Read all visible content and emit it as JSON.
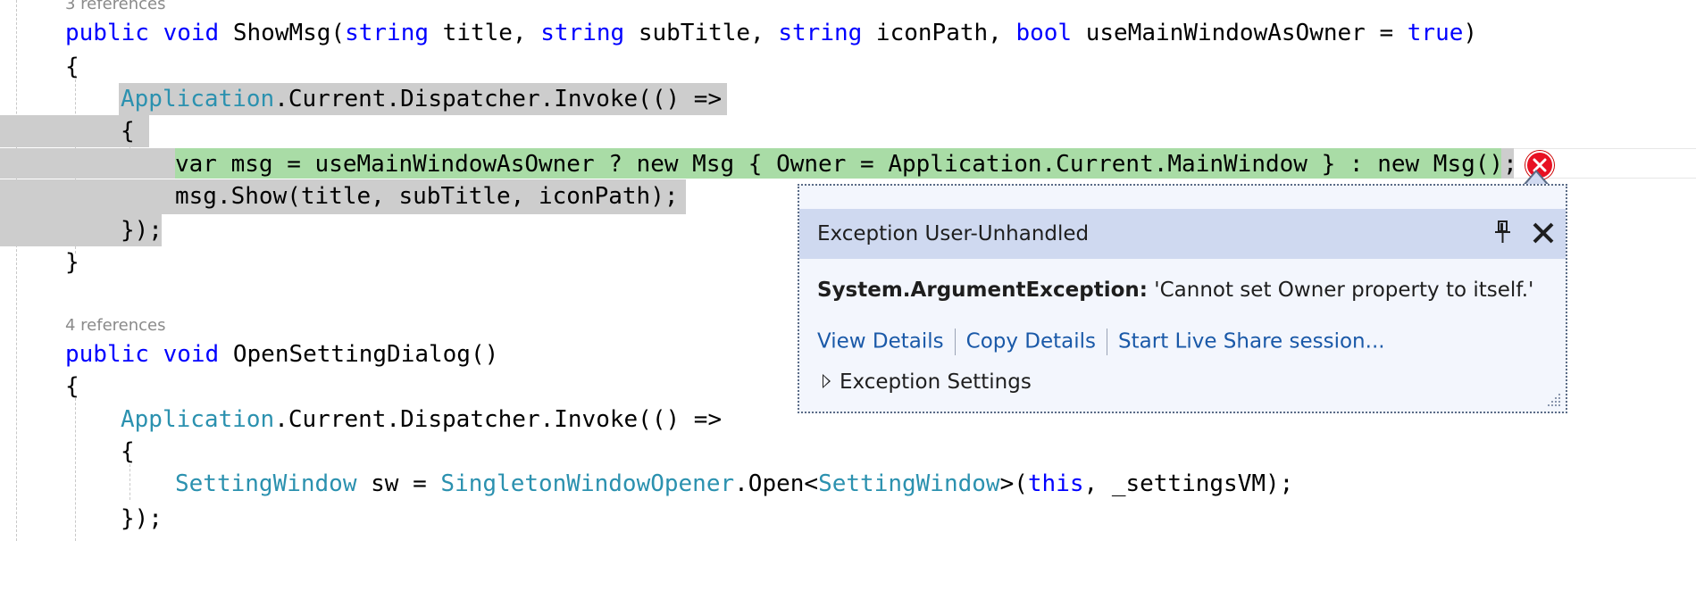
{
  "codelens": {
    "top": "3 references",
    "open_setting_dialog": "4 references"
  },
  "code": {
    "l1": {
      "kw_public": "public",
      "kw_void": "void",
      "name": " ShowMsg(",
      "kw_string1": "string",
      "p1": " title, ",
      "kw_string2": "string",
      "p2": " subTitle, ",
      "kw_string3": "string",
      "p3": " iconPath, ",
      "kw_bool": "bool",
      "p4": " useMainWindowAsOwner = ",
      "kw_true": "true",
      "end": ")"
    },
    "l2": "{",
    "l3": {
      "type": "Application",
      "rest": ".Current.Dispatcher.Invoke(() =>"
    },
    "l4": "{",
    "l5": {
      "kw_var": "var",
      "rest": " msg = useMainWindowAsOwner ? new Msg { Owner = Application.Current.MainWindow } : new Msg();"
    },
    "l6": "msg.Show(title, subTitle, iconPath);",
    "l7": "});",
    "l8": "}",
    "l9": {
      "kw_public": "public",
      "kw_void": "void",
      "rest": " OpenSettingDialog()"
    },
    "l10": "{",
    "l11": {
      "type": "Application",
      "rest": ".Current.Dispatcher.Invoke(() =>"
    },
    "l12": "{",
    "l13": {
      "type1": "SettingWindow",
      "p1": " sw = ",
      "type2": "SingletonWindowOpener",
      "p2": ".Open<",
      "type3": "SettingWindow",
      "p3": ">(",
      "kw_this": "this",
      "p4": ", _settingsVM);"
    },
    "l14": "});"
  },
  "exception_popup": {
    "title": "Exception User-Unhandled",
    "exception_type": "System.ArgumentException:",
    "message": " 'Cannot set Owner property to itself.'",
    "links": {
      "view_details": "View Details",
      "copy_details": "Copy Details",
      "live_share": "Start Live Share session..."
    },
    "settings_label": "Exception Settings"
  },
  "icons": {
    "error": "error-circle-icon",
    "pin": "pin-icon",
    "close": "close-icon",
    "expand": "expand-triangle-icon",
    "grip": "resize-grip-icon"
  },
  "colors": {
    "keyword": "#0000ff",
    "type": "#2b91af",
    "highlight_gray": "#cdcdcd",
    "highlight_green": "#a9dca6",
    "link": "#1a59a8",
    "popup_header": "#cfd9f0",
    "error_red": "#e81123"
  }
}
